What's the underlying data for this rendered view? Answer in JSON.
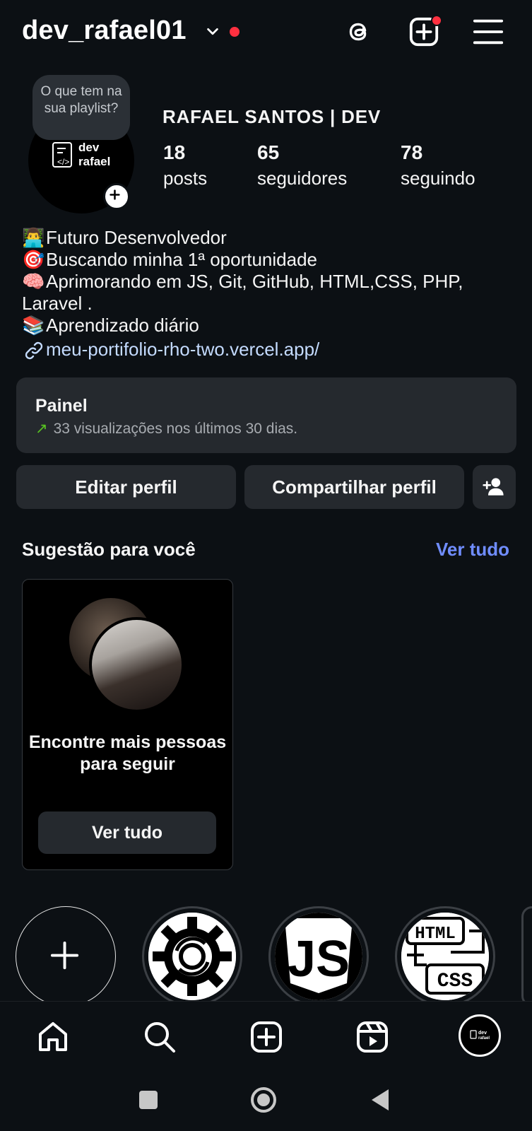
{
  "header": {
    "username": "dev_rafael01",
    "icons": [
      "threads-icon",
      "create-icon",
      "menu-icon"
    ]
  },
  "profile": {
    "note": "O que tem na sua playlist?",
    "avatar_text_line1": "dev",
    "avatar_text_line2": "</> rafael",
    "full_name": "RAFAEL SANTOS | DEV",
    "stats": [
      {
        "value": "18",
        "label": "posts"
      },
      {
        "value": "65",
        "label": "seguidores"
      },
      {
        "value": "78",
        "label": "seguindo"
      }
    ]
  },
  "bio": {
    "lines": [
      {
        "emoji": "👨‍💻",
        "text": "Futuro Desenvolvedor"
      },
      {
        "emoji": "🎯",
        "text": "Buscando minha 1ª oportunidade"
      },
      {
        "emoji": "🧠",
        "text": "Aprimorando em JS, Git, GitHub, HTML,CSS, PHP,"
      },
      {
        "emoji": "",
        "text": "Laravel ."
      },
      {
        "emoji": "📚",
        "text": "Aprendizado diário"
      }
    ],
    "link": "meu-portifolio-rho-two.vercel.app/"
  },
  "dashboard": {
    "title": "Painel",
    "subtitle": "33 visualizações nos últimos 30 dias."
  },
  "buttons": {
    "edit": "Editar perfil",
    "share": "Compartilhar perfil"
  },
  "suggestions": {
    "title": "Sugestão para você",
    "see_all": "Ver tudo",
    "card_text": "Encontre mais pessoas para seguir",
    "card_button": "Ver tudo"
  },
  "highlights": {
    "items": [
      "settings-gear-icon",
      "javascript-icon",
      "html-css-icon"
    ]
  },
  "bottom_nav": {
    "items": [
      "home-icon",
      "search-icon",
      "create-icon",
      "reels-icon",
      "profile-avatar"
    ]
  },
  "colors": {
    "background": "#0c1014",
    "surface": "#25292e",
    "link": "#c4dbff",
    "accent_blue": "#708dff",
    "notification_red": "#ff3040",
    "trend_green": "#58c322"
  }
}
